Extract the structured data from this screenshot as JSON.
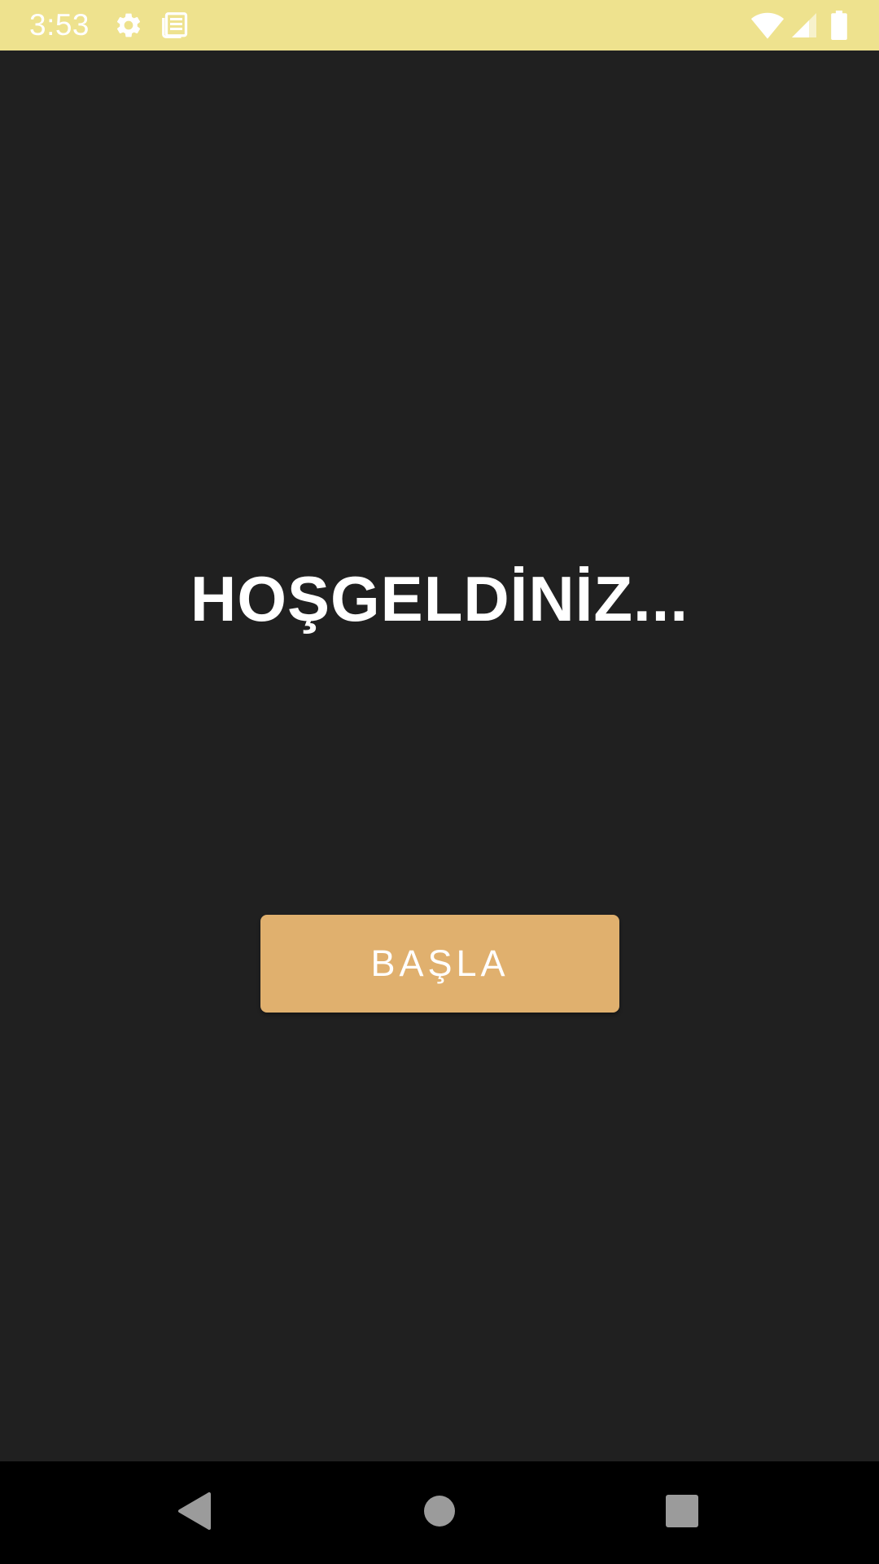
{
  "status_bar": {
    "time": "3:53",
    "icons": [
      "gear-icon",
      "news-icon",
      "wifi-icon",
      "signal-icon",
      "battery-icon"
    ],
    "background_color": "#EEE28E"
  },
  "main": {
    "title": "HOŞGELDİNİZ...",
    "start_button_label": "BAŞLA",
    "background_color": "#202020",
    "button_color": "#E0B06E"
  },
  "nav_bar": {
    "buttons": [
      "back-icon",
      "home-icon",
      "recents-icon"
    ]
  }
}
